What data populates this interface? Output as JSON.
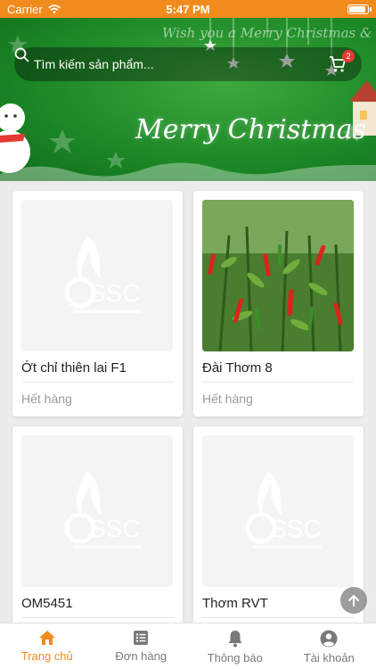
{
  "status_bar": {
    "carrier": "Carrier",
    "time": "5:47 PM"
  },
  "banner": {
    "script_text": "Wish you a Merry Christmas & Happy",
    "title": "Merry Christmas"
  },
  "search": {
    "placeholder": "Tìm kiếm sản phẩm..."
  },
  "cart": {
    "badge_count": "2"
  },
  "products": [
    {
      "name": "Ớt chỉ thiên lai F1",
      "status": "Hết hàng",
      "image": "ssc-placeholder"
    },
    {
      "name": "Đài Thơm 8",
      "status": "Hết hàng",
      "image": "chili-photo"
    },
    {
      "name": "OM5451",
      "status": "",
      "image": "ssc-placeholder"
    },
    {
      "name": "Thơm RVT",
      "status": "",
      "image": "ssc-placeholder"
    }
  ],
  "placeholder_logo_text": "SSC",
  "tabs": [
    {
      "label": "Trang chủ",
      "icon": "home-icon",
      "active": true
    },
    {
      "label": "Đơn hàng",
      "icon": "list-icon",
      "active": false
    },
    {
      "label": "Thông báo",
      "icon": "bell-icon",
      "active": false
    },
    {
      "label": "Tài khoản",
      "icon": "account-icon",
      "active": false
    }
  ],
  "colors": {
    "accent": "#f28b1d",
    "banner_green": "#1d8a27",
    "badge_red": "#e53935"
  }
}
